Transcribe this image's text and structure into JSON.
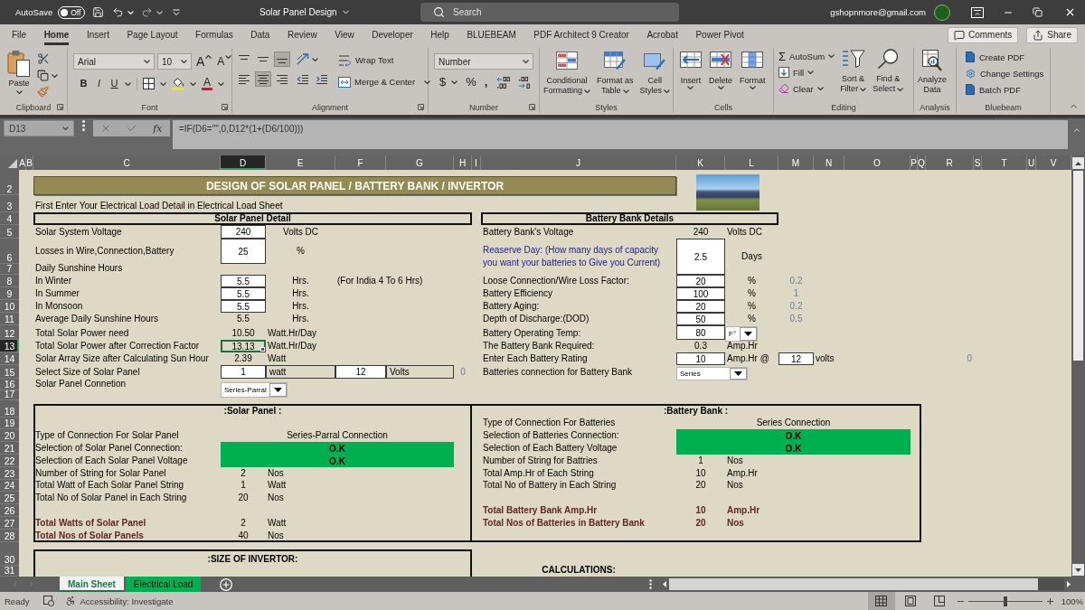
{
  "title_bar": {
    "autosave": {
      "label": "AutoSave",
      "on": false,
      "state_text": "Off"
    },
    "document_title": "Solar Panel Design",
    "search": {
      "placeholder": "Search"
    },
    "account": "gshopnmore@gmail.com"
  },
  "ribbon_tabs": [
    {
      "label": "File",
      "selected": false
    },
    {
      "label": "Home",
      "selected": true
    },
    {
      "label": "Insert",
      "selected": false
    },
    {
      "label": "Page Layout",
      "selected": false
    },
    {
      "label": "Formulas",
      "selected": false
    },
    {
      "label": "Data",
      "selected": false
    },
    {
      "label": "Review",
      "selected": false
    },
    {
      "label": "View",
      "selected": false
    },
    {
      "label": "Developer",
      "selected": false
    },
    {
      "label": "Help",
      "selected": false
    },
    {
      "label": "BLUEBEAM",
      "selected": false
    },
    {
      "label": "PDF Architect 9 Creator",
      "selected": false
    },
    {
      "label": "Acrobat",
      "selected": false
    },
    {
      "label": "Power Pivot",
      "selected": false
    }
  ],
  "ribbon_actions": {
    "comments": "Comments",
    "share": "Share"
  },
  "ribbon": {
    "clipboard": {
      "paste": "Paste",
      "group_label": "Clipboard"
    },
    "font": {
      "font_name": "Arial",
      "font_size": "10",
      "grow_font": "A",
      "shrink_font": "A",
      "styles": [
        "B",
        "I",
        "U"
      ],
      "font_color": "A",
      "group_label": "Font"
    },
    "alignment": {
      "vertical": [
        {
          "selected": false
        },
        {
          "selected": false
        },
        {
          "selected": true
        }
      ],
      "horizontal": [
        {
          "selected": false
        },
        {
          "selected": true
        },
        {
          "selected": false
        }
      ],
      "wrap_text": "Wrap Text",
      "merge": "Merge & Center",
      "group_label": "Alignment"
    },
    "number": {
      "format": "Number",
      "currency": "$",
      "percent": "%",
      "comma": ",",
      "group_label": "Number"
    },
    "styles": {
      "buttons": [
        [
          "Conditional",
          "Formatting"
        ],
        [
          "Format as",
          "Table"
        ],
        [
          "Cell",
          "Styles"
        ]
      ],
      "group_label": "Styles"
    },
    "cells": {
      "buttons": [
        "Insert",
        "Delete",
        "Format"
      ],
      "group_label": "Cells"
    },
    "editing": {
      "autosum_symbol": "Σ",
      "autosum": "AutoSum",
      "fill": "Fill",
      "clear": "Clear",
      "sort_filter": [
        "Sort &",
        "Filter"
      ],
      "find_select": [
        "Find &",
        "Select"
      ],
      "group_label": "Editing"
    },
    "analysis": {
      "analyze_data": [
        "Analyze",
        "Data"
      ],
      "group_label": "Analysis"
    },
    "bluebeam": {
      "actions": [
        "Create PDF",
        "Change Settings",
        "Batch PDF"
      ],
      "group_label": "Bluebeam"
    }
  },
  "formula_bar": {
    "name_box": "D13",
    "function_label": "fx",
    "formula": "=IF(D6=\"\",0,D12*(1+(D6/100)))"
  },
  "columns": [
    {
      "label": "A",
      "selected": false
    },
    {
      "label": "B",
      "selected": false
    },
    {
      "label": "C",
      "selected": false
    },
    {
      "label": "D",
      "selected": true
    },
    {
      "label": "E",
      "selected": false
    },
    {
      "label": "F",
      "selected": false
    },
    {
      "label": "G",
      "selected": false
    },
    {
      "label": "H",
      "selected": false
    },
    {
      "label": "I",
      "selected": false
    },
    {
      "label": "J",
      "selected": false
    },
    {
      "label": "K",
      "selected": false
    },
    {
      "label": "L",
      "selected": false
    },
    {
      "label": "M",
      "selected": false
    },
    {
      "label": "N",
      "selected": false
    },
    {
      "label": "O",
      "selected": false
    },
    {
      "label": "P",
      "selected": false
    },
    {
      "label": "Q",
      "selected": false
    },
    {
      "label": "R",
      "selected": false
    },
    {
      "label": "S",
      "selected": false
    },
    {
      "label": "T",
      "selected": false
    },
    {
      "label": "U",
      "selected": false
    },
    {
      "label": "V",
      "selected": false
    }
  ],
  "rows": [
    {
      "label": "2",
      "selected": false
    },
    {
      "label": "3",
      "selected": false
    },
    {
      "label": "4",
      "selected": false
    },
    {
      "label": "5",
      "selected": false
    },
    {
      "label": "6",
      "selected": false
    },
    {
      "label": "7",
      "selected": false
    },
    {
      "label": "8",
      "selected": false
    },
    {
      "label": "9",
      "selected": false
    },
    {
      "label": "10",
      "selected": false
    },
    {
      "label": "11",
      "selected": false
    },
    {
      "label": "12",
      "selected": false
    },
    {
      "label": "13",
      "selected": true
    },
    {
      "label": "14",
      "selected": false
    },
    {
      "label": "15",
      "selected": false
    },
    {
      "label": "16",
      "selected": false
    },
    {
      "label": "17",
      "selected": false
    },
    {
      "label": "18",
      "selected": false
    },
    {
      "label": "19",
      "selected": false
    },
    {
      "label": "20",
      "selected": false
    },
    {
      "label": "21",
      "selected": false
    },
    {
      "label": "22",
      "selected": false
    },
    {
      "label": "23",
      "selected": false
    },
    {
      "label": "24",
      "selected": false
    },
    {
      "label": "25",
      "selected": false
    },
    {
      "label": "26",
      "selected": false
    },
    {
      "label": "27",
      "selected": false
    },
    {
      "label": "28",
      "selected": false
    },
    {
      "label": "30",
      "selected": false
    },
    {
      "label": "31",
      "selected": false
    }
  ],
  "sheet": {
    "title": "DESIGN OF SOLAR PANEL / BATTERY BANK / INVERTOR",
    "instruction": "First Enter Your Electrical Load Detail in Electrical Load Sheet",
    "solar_panel_detail": {
      "heading": "Solar Panel Detail",
      "rows": [
        {
          "label": "Solar System Voltage",
          "kind": "input",
          "value": "240",
          "unit": "Volts DC",
          "selected": false
        },
        {
          "label": "Losses in Wire,Connection,Battery",
          "kind": "input",
          "value": "25",
          "unit": "%",
          "selected": false
        },
        {
          "label": "Daily Sunshine Hours",
          "kind": "label",
          "selected": false
        },
        {
          "label": "In Winter",
          "kind": "input",
          "value": "5.5",
          "unit": "Hrs.",
          "note": "(For India 4 To 6 Hrs)",
          "selected": false
        },
        {
          "label": "In Summer",
          "kind": "input",
          "value": "5.5",
          "unit": "Hrs.",
          "selected": false
        },
        {
          "label": "In Monsoon",
          "kind": "input",
          "value": "5.5",
          "unit": "Hrs.",
          "selected": false
        },
        {
          "label": "Average Daily Sunshine Hours",
          "kind": "computed",
          "value": "5.5",
          "unit": "Hrs.",
          "selected": false
        },
        {
          "label": "Total Solar Power need",
          "kind": "computed",
          "value": "10.50",
          "unit": "Watt.Hr/Day",
          "selected": false
        },
        {
          "label": "Total Solar Power after Correction Factor",
          "kind": "computed",
          "value": "13.13",
          "unit": "Watt.Hr/Day",
          "selected": true
        },
        {
          "label": "Solar Array Size after Calculating Sun Hour",
          "kind": "computed",
          "value": "2.39",
          "unit": "Watt",
          "selected": false
        },
        {
          "label": "Select Size of Solar Panel",
          "kind": "panel_size",
          "value": "1",
          "unit": "watt",
          "voltage": "12",
          "voltage_unit": "Volts",
          "check": "0",
          "selected": false
        },
        {
          "label": "Solar Panel Connetion",
          "kind": "dropdown",
          "value": "Series-Parral",
          "selected": false
        }
      ]
    },
    "battery_bank_details": {
      "heading": "Battery Bank Details",
      "rows": [
        {
          "label": "Battery Bank's Voltage",
          "kind": "computed",
          "value": "240",
          "unit": "Volts DC",
          "selected": false
        },
        {
          "label": "Reaserve Day: (How many days of capacity you want your batteries to Give you Current)",
          "kind": "prompt",
          "value": "2.5",
          "unit": "Days",
          "selected": false
        },
        {
          "label": "Loose Connection/Wire Loss Factor:",
          "kind": "input",
          "value": "20",
          "unit": "%",
          "factor": "0.2",
          "selected": false
        },
        {
          "label": "Battery Efficiency",
          "kind": "input",
          "value": "100",
          "unit": "%",
          "factor": "1",
          "selected": false
        },
        {
          "label": "Battery Aging:",
          "kind": "input",
          "value": "20",
          "unit": "%",
          "factor": "0.2",
          "selected": false
        },
        {
          "label": "Depth of Discharge:(DOD)",
          "kind": "input",
          "value": "50",
          "unit": "%",
          "factor": "0.5",
          "selected": false
        },
        {
          "label": "Battery Operating Temp:",
          "kind": "input_dropdown",
          "value": "80",
          "option": "F°",
          "selected": false
        },
        {
          "label": "The Battery Bank Required:",
          "kind": "computed",
          "value": "0.3",
          "unit": "Amp.Hr",
          "selected": false
        },
        {
          "label": "Enter Each Battery Rating",
          "kind": "rating",
          "value": "10",
          "unit": "Amp.Hr @",
          "voltage": "12",
          "voltage_unit": "volts",
          "check": "0",
          "selected": false
        },
        {
          "label": "Batteries connection for Battery Bank",
          "kind": "dropdown",
          "value": "Series",
          "selected": false
        }
      ]
    },
    "solar_panel_summary": {
      "heading": ":Solar Panel :",
      "rows": [
        {
          "label": "Type of Connection For Solar Panel",
          "kind": "text",
          "value": "Series-Parral Connection"
        },
        {
          "label": "Selection of Solar Panel Connection:",
          "kind": "status",
          "value": "O.K"
        },
        {
          "label": "Selection of Each Solar Panel Voltage",
          "kind": "status",
          "value": "O.K"
        },
        {
          "label": "Number of String for Solar Panel",
          "kind": "count",
          "value": "2",
          "unit": "Nos"
        },
        {
          "label": "Total Watt of Each Solar Panel String",
          "kind": "count",
          "value": "1",
          "unit": "Watt"
        },
        {
          "label": "Total No of Solar Panel in Each String",
          "kind": "count",
          "value": "20",
          "unit": "Nos"
        },
        {
          "label": "Total Watts of Solar Panel",
          "kind": "total",
          "value": "2",
          "unit": "Watt"
        },
        {
          "label": "Total Nos of Solar Panels",
          "kind": "total",
          "value": "40",
          "unit": "Nos"
        }
      ]
    },
    "battery_bank_summary": {
      "heading": ":Battery Bank :",
      "rows": [
        {
          "label": "Type of Connection For Batteries",
          "kind": "text",
          "value": "Series Connection"
        },
        {
          "label": "Selection of Batteries Connection:",
          "kind": "status",
          "value": "O.K"
        },
        {
          "label": "Selection of Each Battery Voltage",
          "kind": "status",
          "value": "O.K"
        },
        {
          "label": "Number of String for Battries",
          "kind": "count",
          "value": "1",
          "unit": "Nos"
        },
        {
          "label": "Total Amp.Hr of Each String",
          "kind": "count",
          "value": "10",
          "unit": "Amp.Hr"
        },
        {
          "label": "Total No of Battery in Each String",
          "kind": "count",
          "value": "20",
          "unit": "Nos"
        },
        {
          "label": "Total Battery Bank Amp.Hr",
          "kind": "grand_total",
          "value": "10",
          "unit": "Amp.Hr"
        },
        {
          "label": "Total Nos of Batteries in Battery Bank",
          "kind": "grand_total",
          "value": "20",
          "unit": "Nos"
        }
      ]
    },
    "inverter_size": {
      "heading": ":SIZE OF INVERTOR:"
    },
    "calculations": {
      "heading": "CALCULATIONS:"
    }
  },
  "sheet_tabs": [
    {
      "label": "Main Sheet",
      "selected": true
    },
    {
      "label": "Electrical Load",
      "selected": false,
      "color": "#00b050"
    }
  ],
  "status_bar": {
    "mode": "Ready",
    "accessibility": "Accessibility: Investigate",
    "views": [
      {
        "selected": true
      },
      {
        "selected": false
      },
      {
        "selected": false
      }
    ],
    "zoom": {
      "level": 0.5,
      "reading": "100%"
    }
  }
}
